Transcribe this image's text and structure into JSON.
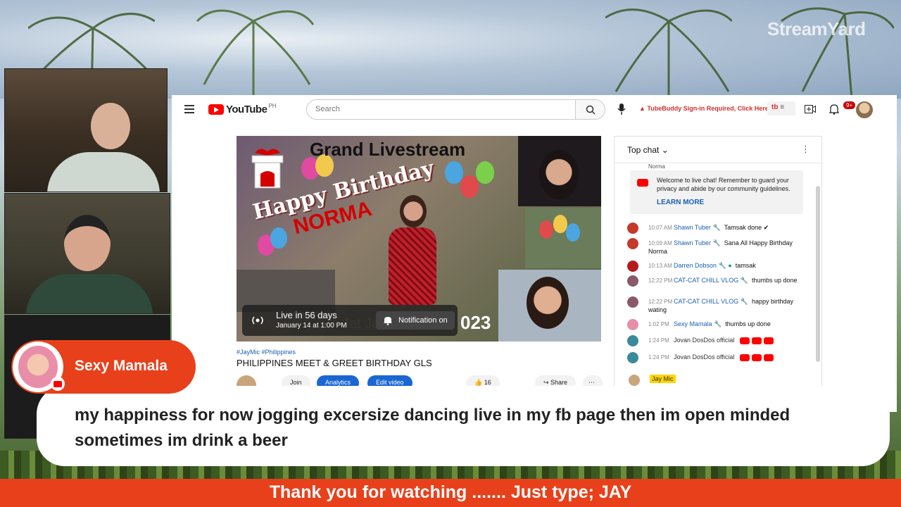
{
  "watermark": "StreamYard",
  "youtube": {
    "logo_text": "YouTube",
    "region": "PH",
    "search_placeholder": "Search",
    "tubebuddy_notice": "TubeBuddy Sign-in Required, Click Here",
    "tb_label": "tb",
    "notifications_badge": "9+"
  },
  "video": {
    "thumb_title": "Grand Livestream",
    "happy_birthday": "Happy Birthday",
    "name": "NORMA",
    "live_status": "Live in 56 days",
    "live_date": "January 14 at 1:00 PM",
    "notification_button": "Notification on",
    "year_fragment": "023",
    "tags": "#JayMic #Philippines",
    "title": "PHILIPPINES MEET & GREET BIRTHDAY GLS",
    "actions": {
      "join": "Join",
      "analytics": "Analytics",
      "edit_video": "Edit video",
      "likes": "16",
      "share": "Share"
    }
  },
  "chat": {
    "header": "Top chat",
    "truncated_name": "Norma",
    "welcome_text": "Welcome to live chat! Remember to guard your privacy and abide by our community guidelines.",
    "learn_more": "LEARN MORE",
    "messages": [
      {
        "time": "10:07 AM",
        "author": "Shawn Tuber",
        "text": "Tamsak done ✔"
      },
      {
        "time": "10:09 AM",
        "author": "Shawn Tuber",
        "text": "Sana All Happy Birthday Norma"
      },
      {
        "time": "10:13 AM",
        "author": "Darren Dobson",
        "text": "tamsak"
      },
      {
        "time": "12:22 PM",
        "author": "CAT-CAT CHILL VLOG",
        "text": "thumbs up done"
      },
      {
        "time": "12:22 PM",
        "author": "CAT-CAT CHILL VLOG",
        "text": "happy birthday wating"
      },
      {
        "time": "1:02 PM",
        "author": "Sexy Mamala",
        "text": "thumbs up done"
      },
      {
        "time": "1:24 PM",
        "author": "Jovan DosDos official",
        "text": ""
      },
      {
        "time": "1:24 PM",
        "author": "Jovan DosDos official",
        "text": ""
      }
    ],
    "current_user": "Jay Mic"
  },
  "overlay": {
    "commenter_name": "Sexy Mamala",
    "comment": "my happiness for now jogging excersize dancing live in my fb page then im open minded sometimes im drink a beer",
    "ticker": "Thank you for watching ....... Just type; JAY"
  },
  "colors": {
    "accent": "#e8401a",
    "youtube_red": "#ff0000",
    "link_blue": "#1a5fb4"
  }
}
